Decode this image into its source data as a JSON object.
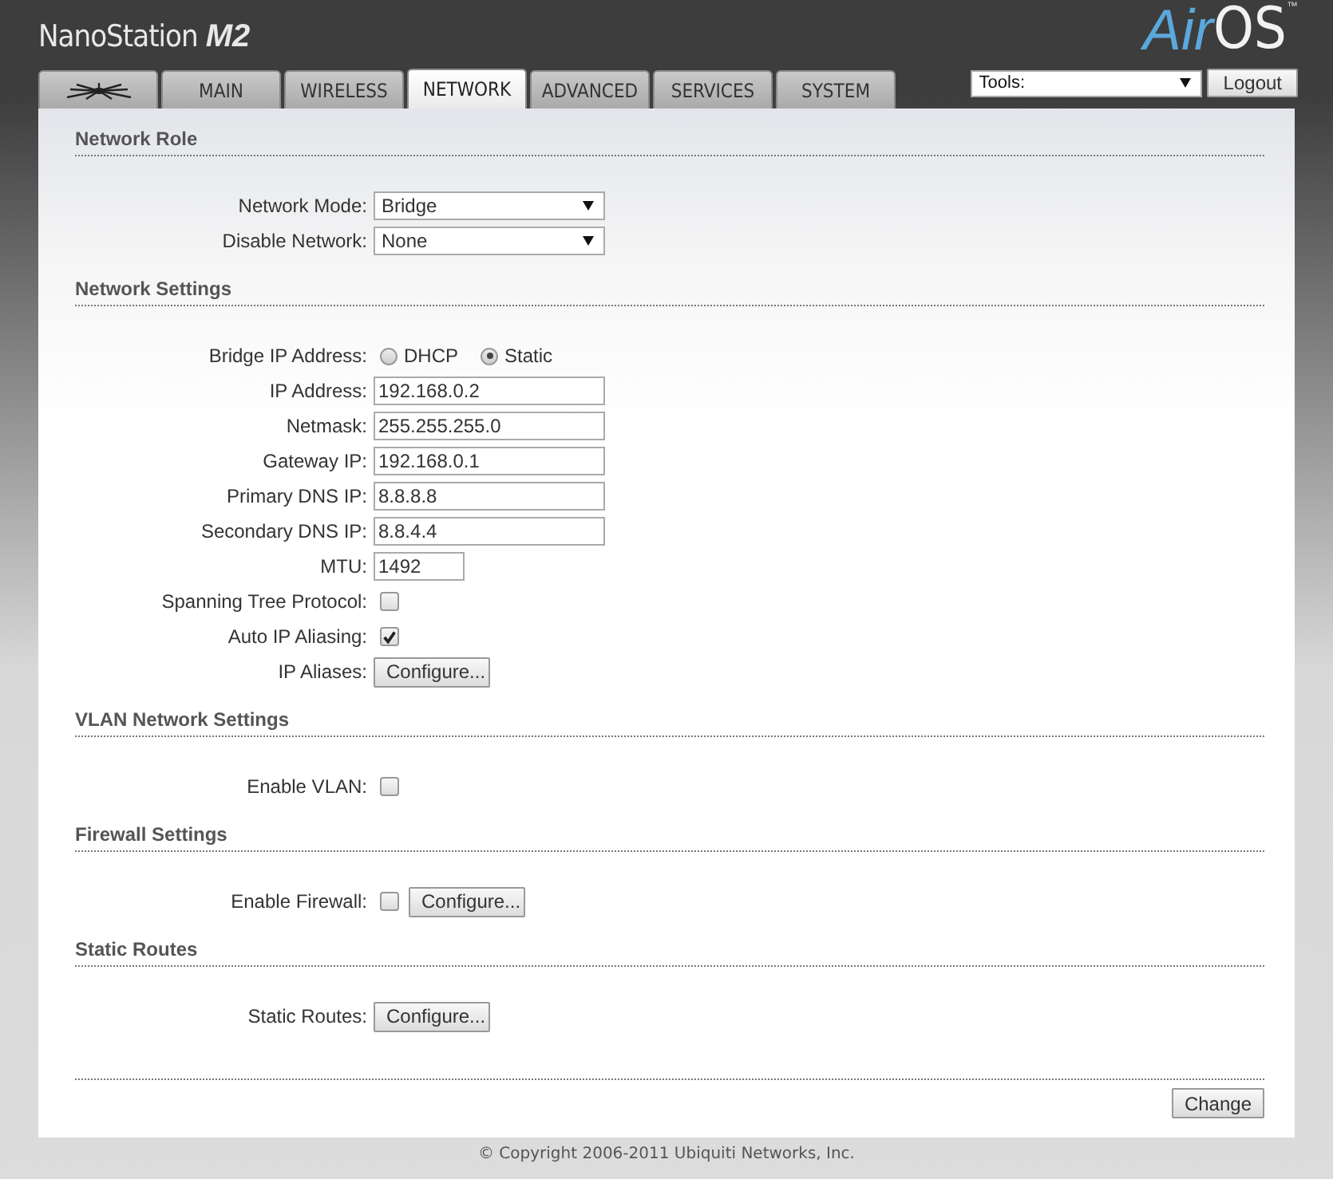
{
  "header": {
    "brand": "NanoStation",
    "model": "M2",
    "logo_air": "Air",
    "logo_os": "OS",
    "logo_mark": "™",
    "tools": {
      "value": "Tools:"
    },
    "logout": "Logout"
  },
  "tabs": [
    {
      "kind": "icon",
      "selected": false
    },
    {
      "kind": "text",
      "label": "MAIN",
      "selected": false
    },
    {
      "kind": "text",
      "label": "WIRELESS",
      "selected": false
    },
    {
      "kind": "text",
      "label": "NETWORK",
      "selected": true
    },
    {
      "kind": "text",
      "label": "ADVANCED",
      "selected": false
    },
    {
      "kind": "text",
      "label": "SERVICES",
      "selected": false
    },
    {
      "kind": "text",
      "label": "SYSTEM",
      "selected": false
    }
  ],
  "sections": [
    {
      "title": "Network Role",
      "rows": [
        {
          "kind": "select",
          "label": "Network Mode:",
          "value": "Bridge"
        },
        {
          "kind": "select",
          "label": "Disable Network:",
          "value": "None"
        }
      ]
    },
    {
      "title": "Network Settings",
      "rows": [
        {
          "kind": "radio",
          "label": "Bridge IP Address:",
          "options": [
            {
              "label": "DHCP",
              "selected": false
            },
            {
              "label": "Static",
              "selected": true
            }
          ]
        },
        {
          "kind": "text",
          "label": "IP Address:",
          "value": "192.168.0.2"
        },
        {
          "kind": "text",
          "label": "Netmask:",
          "value": "255.255.255.0"
        },
        {
          "kind": "text",
          "label": "Gateway IP:",
          "value": "192.168.0.1"
        },
        {
          "kind": "text",
          "label": "Primary DNS IP:",
          "value": "8.8.8.8"
        },
        {
          "kind": "text",
          "label": "Secondary DNS IP:",
          "value": "8.8.4.4"
        },
        {
          "kind": "number",
          "label": "MTU:",
          "value": "1492"
        },
        {
          "kind": "checkbox",
          "label": "Spanning Tree Protocol:",
          "checked": false
        },
        {
          "kind": "checkbox",
          "label": "Auto IP Aliasing:",
          "checked": true
        },
        {
          "kind": "button",
          "label": "IP Aliases:",
          "button": "Configure..."
        }
      ]
    },
    {
      "title": "VLAN Network Settings",
      "rows": [
        {
          "kind": "checkbox",
          "label": "Enable VLAN:",
          "checked": false
        }
      ]
    },
    {
      "title": "Firewall Settings",
      "rows": [
        {
          "kind": "checkbox_button",
          "label": "Enable Firewall:",
          "checked": false,
          "button": "Configure..."
        }
      ]
    },
    {
      "title": "Static Routes",
      "rows": [
        {
          "kind": "button",
          "label": "Static Routes:",
          "button": "Configure..."
        }
      ]
    }
  ],
  "change_button": "Change",
  "copyright": "© Copyright 2006-2011 Ubiquiti Networks, Inc."
}
